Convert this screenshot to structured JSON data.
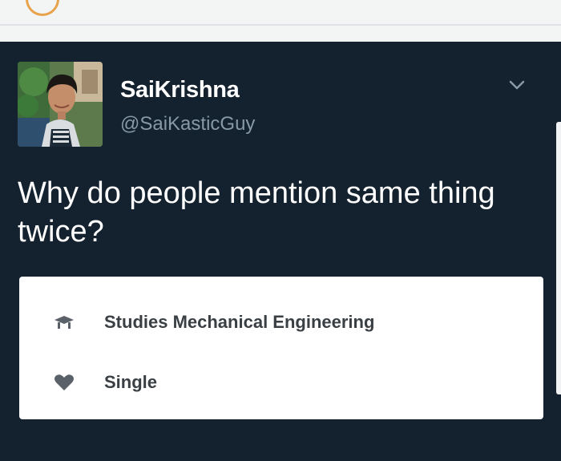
{
  "user": {
    "display_name": "SaiKrishna",
    "handle": "@SaiKasticGuy"
  },
  "tweet": {
    "text": "Why do people mention same thing twice?"
  },
  "profile_card": {
    "items": [
      {
        "icon": "graduation-cap-icon",
        "label": "Studies Mechanical Engineering"
      },
      {
        "icon": "heart-icon",
        "label": "Single"
      }
    ]
  },
  "colors": {
    "tweet_background": "#14212e",
    "handle_text": "#8899a6",
    "card_icon": "#5a6168"
  }
}
